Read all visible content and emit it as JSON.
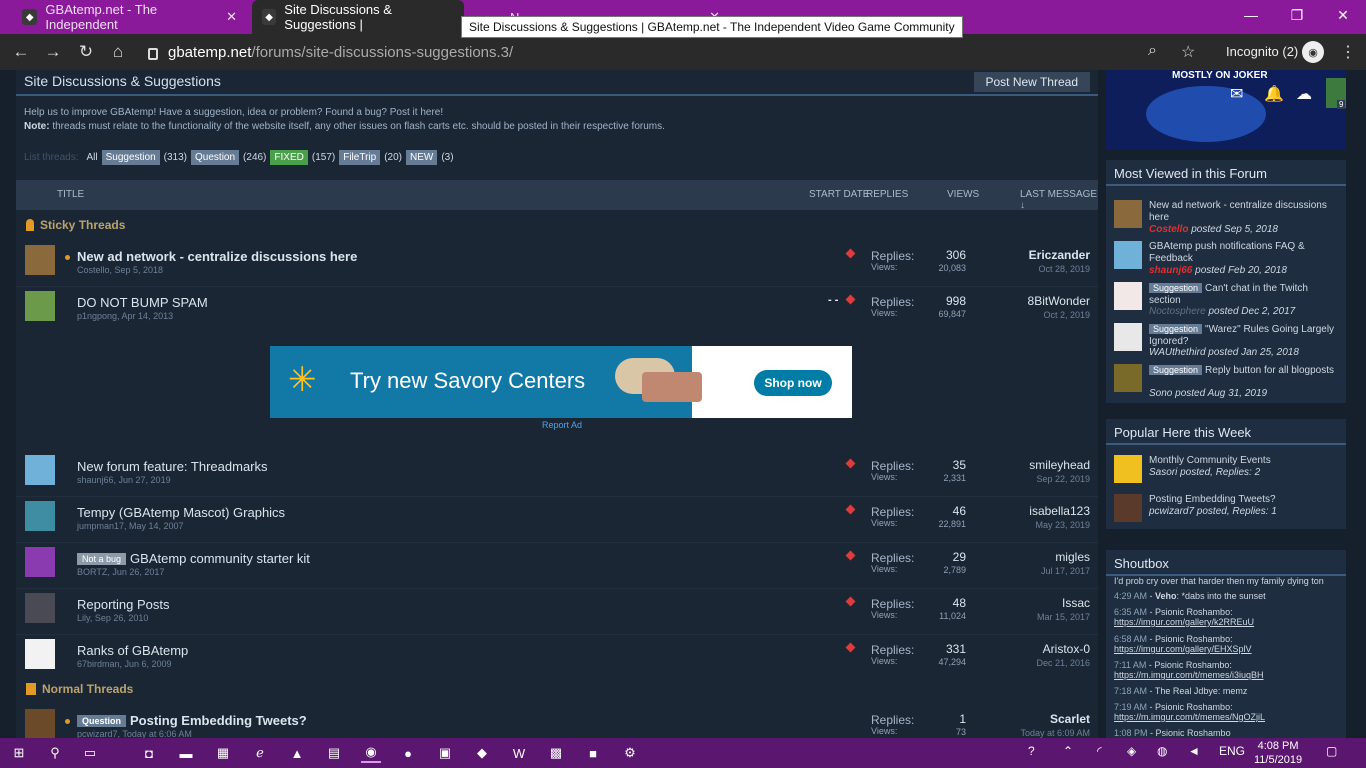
{
  "browser": {
    "tabs": [
      {
        "title": "GBAtemp.net - The Independent",
        "active": false
      },
      {
        "title": "Site Discussions & Suggestions |",
        "active": true
      },
      {
        "title": "N",
        "active": false
      }
    ],
    "tooltip": "Site Discussions & Suggestions | GBAtemp.net - The Independent Video Game Community",
    "url_host": "gbatemp.net",
    "url_path": "/forums/site-discussions-suggestions.3/",
    "incognito_label": "Incognito (2)"
  },
  "forum": {
    "title": "Site Discussions & Suggestions",
    "post_new_thread": "Post New Thread",
    "desc_line1": "Help us to improve GBAtemp! Have a suggestion, idea or problem? Found a bug? Post it here!",
    "desc_note_label": "Note:",
    "desc_line2": " threads must relate to the functionality of the website itself, any other issues on flash carts etc. should be posted in their respective forums.",
    "filters": {
      "label": "List threads:",
      "all": "All",
      "suggestion": "Suggestion",
      "suggestion_count": "(313)",
      "question": "Question",
      "question_count": "(246)",
      "fixed": "FIXED",
      "fixed_count": "(157)",
      "filetrip": "FileTrip",
      "filetrip_count": "(20)",
      "new": "NEW",
      "new_count": "(3)"
    },
    "columns": {
      "title": "TITLE",
      "start_date": "START DATE",
      "replies": "REPLIES",
      "views": "VIEWS",
      "last_message": "LAST MESSAGE ↓"
    },
    "sticky_label": "Sticky Threads",
    "normal_label": "Normal Threads",
    "replies_label": "Replies:",
    "views_label": "Views:",
    "report_ad": "Report Ad",
    "threads": [
      {
        "title": "New ad network - centralize discussions here",
        "meta": "Costello, Sep 5, 2018",
        "replies": "306",
        "views": "20,083",
        "last_user": "Ericzander",
        "last_date": "Oct 28, 2019",
        "bold": true
      },
      {
        "title": "DO NOT BUMP SPAM",
        "meta": "p1ngpong, Apr 14, 2013",
        "replies": "998",
        "views": "69,847",
        "last_user": "8BitWonder",
        "last_date": "Oct 2, 2019",
        "dash": "- -"
      },
      {
        "title": "New forum feature: Threadmarks",
        "meta": "shaunj66, Jun 27, 2019",
        "replies": "35",
        "views": "2,331",
        "last_user": "smileyhead",
        "last_date": "Sep 22, 2019"
      },
      {
        "title": "Tempy (GBAtemp Mascot) Graphics",
        "meta": "jumpman17, May 14, 2007",
        "replies": "46",
        "views": "22,891",
        "last_user": "isabella123",
        "last_date": "May 23, 2019"
      },
      {
        "title": "GBAtemp community starter kit",
        "badge": "Not a bug",
        "meta": "BORTZ, Jun 26, 2017",
        "replies": "29",
        "views": "2,789",
        "last_user": "migles",
        "last_date": "Jul 17, 2017"
      },
      {
        "title": "Reporting Posts",
        "meta": "Lily, Sep 26, 2010",
        "replies": "48",
        "views": "11,024",
        "last_user": "Issac",
        "last_date": "Mar 15, 2017"
      },
      {
        "title": "Ranks of GBAtemp",
        "meta": "67birdman, Jun 6, 2009",
        "replies": "331",
        "views": "47,294",
        "last_user": "Aristox-0",
        "last_date": "Dec 21, 2016"
      },
      {
        "title": "Posting Embedding Tweets?",
        "badge": "Question",
        "meta": "pcwizard7, Today at 6:06 AM",
        "replies": "1",
        "views": "73",
        "last_user": "Scarlet",
        "last_date": "Today at 6:09 AM",
        "bold": true
      }
    ],
    "ad": {
      "headline": "Try new Savory Centers",
      "cta": "Shop now"
    }
  },
  "sidebar": {
    "banner_text": "MOSTLY ON JOKER",
    "banner_badge": "9",
    "most_viewed_title": "Most Viewed in this Forum",
    "most_viewed": [
      {
        "title": "New ad network - centralize discussions here",
        "user": "Costello",
        "posted": "posted Sep 5, 2018"
      },
      {
        "title": "GBAtemp push notifications FAQ & Feedback",
        "user": "shaunj66",
        "posted": "posted Feb 20, 2018"
      },
      {
        "badge": "Suggestion",
        "title": "Can't chat in the Twitch section",
        "user": "Noctosphere",
        "posted": "posted Dec 2, 2017"
      },
      {
        "badge": "Suggestion",
        "title": "\"Warez\" Rules Going Largely Ignored?",
        "user": "WAUthethird",
        "posted": "posted Jan 25, 2018"
      },
      {
        "badge": "Suggestion",
        "title": "Reply button for all blogposts",
        "user": "Sono",
        "posted": "posted Aug 31, 2019"
      }
    ],
    "popular_title": "Popular Here this Week",
    "popular": [
      {
        "title": "Monthly Community Events",
        "by": "Sasori posted, Replies: 2"
      },
      {
        "title": "Posting Embedding Tweets?",
        "by": "pcwizard7 posted, Replies: 1"
      }
    ],
    "shoutbox_title": "Shoutbox",
    "shouts": [
      {
        "line": "I'd prob cry over that harder then my family dying ton"
      },
      {
        "time": "4:29 AM",
        "user": "Veho",
        "msg": ": *dabs into the sunset"
      },
      {
        "time": "6:35 AM",
        "user": "Psionic Roshambo",
        "link": "https://imgur.com/gallery/k2RREuU"
      },
      {
        "time": "6:58 AM",
        "user": "Psionic Roshambo",
        "link": "https://imgur.com/gallery/EHXSplV"
      },
      {
        "time": "7:11 AM",
        "user": "Psionic Roshambo",
        "link": "https://m.imgur.com/t/memes/i3iuqBH"
      },
      {
        "time": "7:18 AM",
        "user": "The Real Jdbye",
        "msg": ": memz"
      },
      {
        "time": "7:19 AM",
        "user": "Psionic Roshambo",
        "link": "https://m.imgur.com/t/memes/NgOZjiL"
      },
      {
        "time": "1:08 PM",
        "user": "Psionic Roshambo"
      }
    ]
  },
  "taskbar": {
    "lang": "ENG",
    "time": "4:08 PM",
    "date": "11/5/2019"
  }
}
